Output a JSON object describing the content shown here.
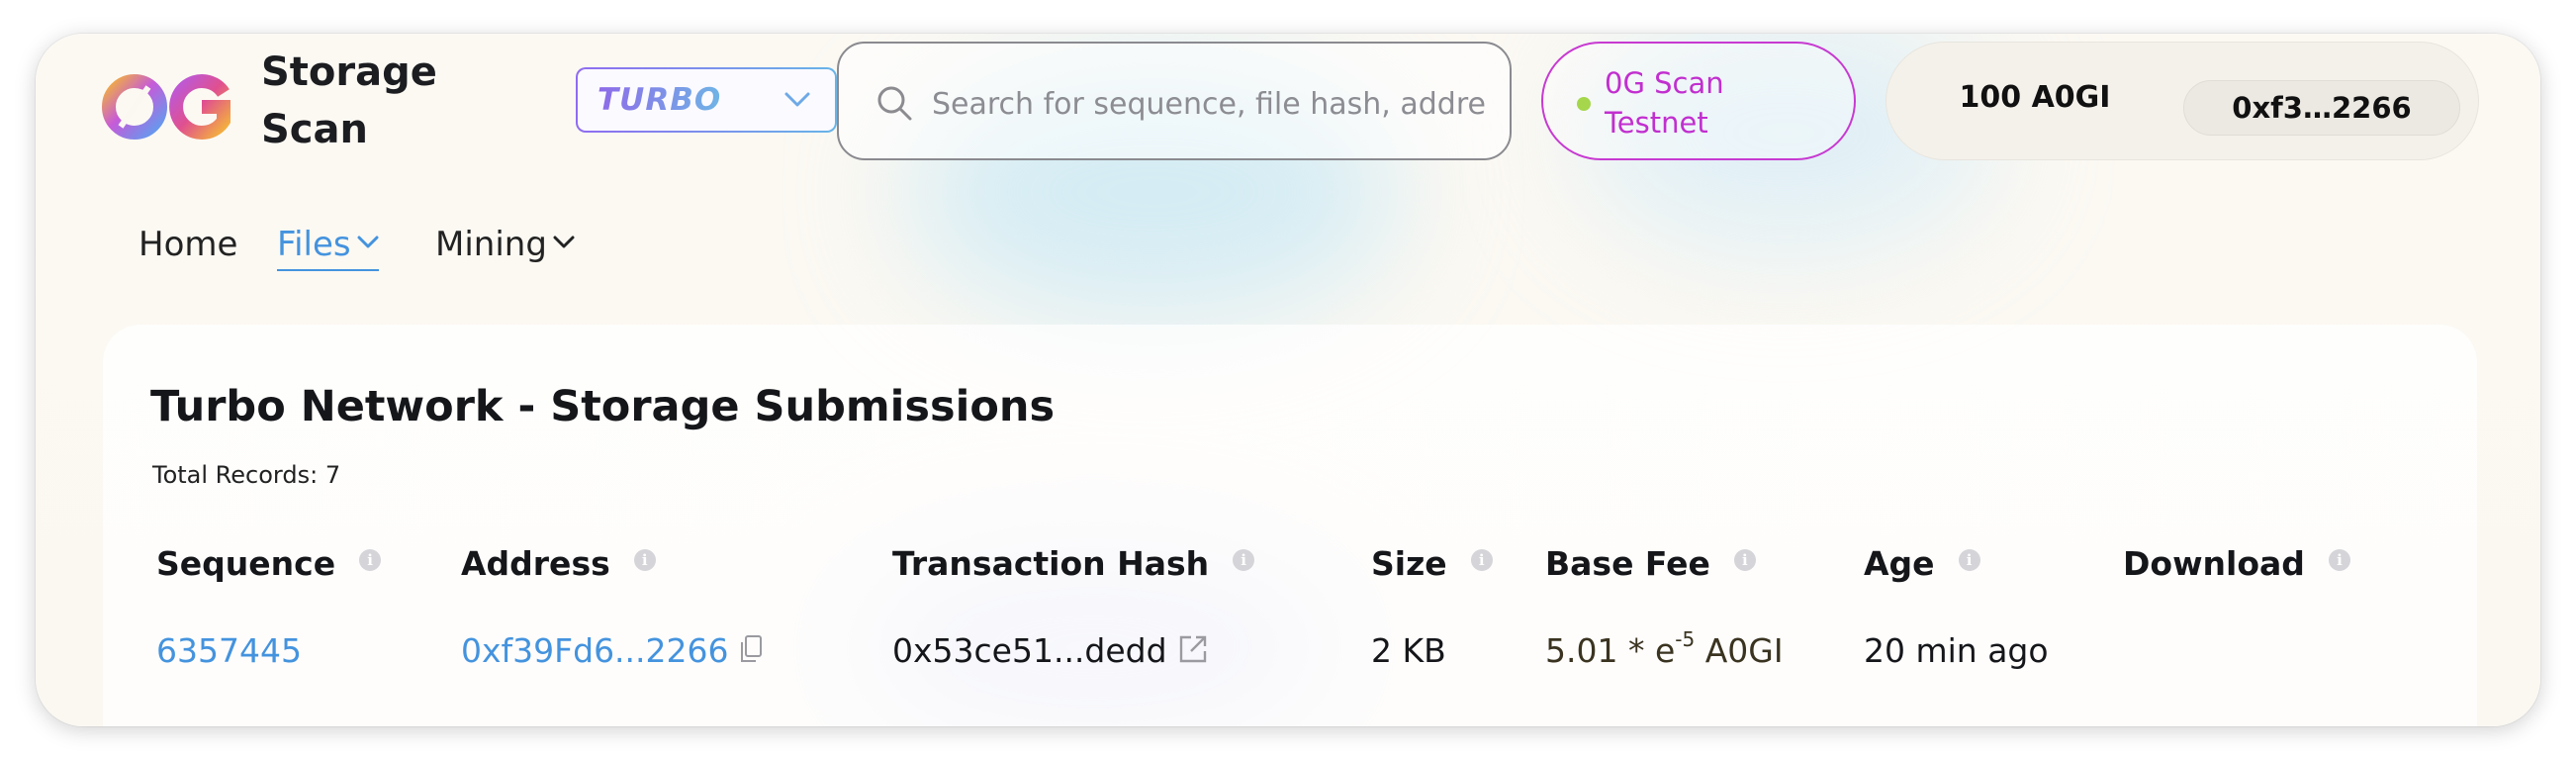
{
  "header": {
    "brand_line1": "Storage",
    "brand_line2": "Scan",
    "network_select_value": "TURBO",
    "search_placeholder": "Search for sequence, file hash, address",
    "network_pill_line1": "0G Scan",
    "network_pill_line2": "Testnet",
    "wallet_balance": "100 A0GI",
    "wallet_address": "0xf3…2266"
  },
  "nav": {
    "items": [
      {
        "label": "Home",
        "active": false,
        "has_dropdown": false
      },
      {
        "label": "Files",
        "active": true,
        "has_dropdown": true
      },
      {
        "label": "Mining",
        "active": false,
        "has_dropdown": true
      }
    ]
  },
  "card": {
    "title": "Turbo Network - Storage Submissions",
    "total_records": "Total Records: 7"
  },
  "table": {
    "columns": [
      "Sequence",
      "Address",
      "Transaction Hash",
      "Size",
      "Base Fee",
      "Age",
      "Download"
    ],
    "rows": [
      {
        "sequence": "6357445",
        "address": "0xf39Fd6...2266",
        "tx_hash": "0x53ce51...dedd",
        "size": "2 KB",
        "base_fee_mantissa": "5.01 * e",
        "base_fee_exponent": "-5",
        "base_fee_unit": "A0GI",
        "age": "20 min ago",
        "download": ""
      }
    ]
  },
  "colors": {
    "accent_blue": "#4493de",
    "network_pill": "#c12fcf",
    "status_dot": "#a5d64c"
  },
  "icons": [
    "chevron-down-icon",
    "search-icon",
    "info-icon",
    "copy-icon",
    "external-link-icon"
  ]
}
